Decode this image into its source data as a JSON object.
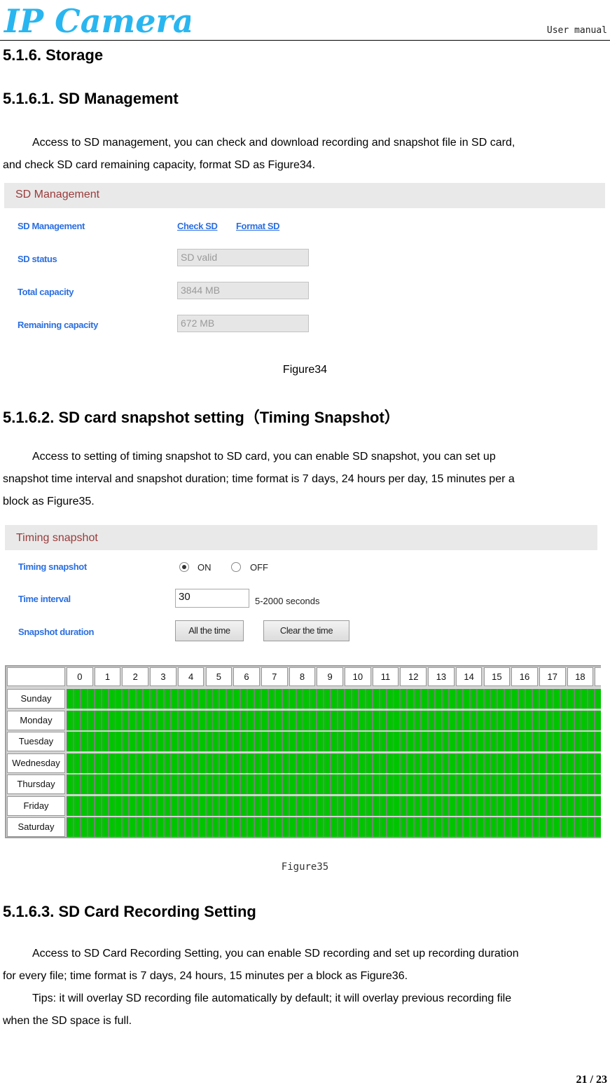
{
  "header": {
    "logo_text": "IP Camera",
    "right_label": "User manual",
    "logo_color": "#29b6f0"
  },
  "sections": {
    "s516": {
      "heading": "5.1.6.  Storage"
    },
    "s5161": {
      "heading": "5.1.6.1. SD Management",
      "paragraph_line1": "Access to SD management, you can check and download recording and snapshot file in SD card,",
      "paragraph_line2": "and check SD card remaining capacity, format SD as Figure34.",
      "caption": "Figure34"
    },
    "s5162": {
      "heading": "5.1.6.2. SD card snapshot setting（Timing Snapshot）",
      "paragraph_line1": "Access to setting of timing snapshot to SD card, you can enable SD snapshot, you can set up",
      "paragraph_line2": "snapshot time interval and snapshot duration; time format is 7 days, 24 hours per day, 15 minutes per a",
      "paragraph_line3": "block as Figure35.",
      "caption": "Figure35"
    },
    "s5163": {
      "heading": "5.1.6.3. SD Card Recording Setting",
      "paragraph1_line1": "Access to SD Card Recording Setting, you can enable SD recording and set up recording duration",
      "paragraph1_line2": "for every file; time format is 7 days, 24 hours, 15 minutes per a block as Figure36.",
      "paragraph2_line1": "Tips: it will overlay SD recording file automatically by default; it will overlay previous recording file",
      "paragraph2_line2": "when the SD space is full."
    }
  },
  "sd_management_panel": {
    "title": "SD Management",
    "row_management_label": "SD Management",
    "check_sd_link": "Check SD",
    "format_sd_link": "Format SD",
    "status_label": "SD status",
    "status_value": "SD valid",
    "total_label": "Total capacity",
    "total_value": "3844 MB",
    "remaining_label": "Remaining capacity",
    "remaining_value": "672 MB"
  },
  "timing_snapshot_panel": {
    "title": "Timing snapshot",
    "enable_label": "Timing snapshot",
    "on_label": "ON",
    "off_label": "OFF",
    "enabled": true,
    "interval_label": "Time interval",
    "interval_value": "30",
    "interval_hint": "5-2000 seconds",
    "duration_label": "Snapshot duration",
    "all_time_button": "All the time",
    "clear_time_button": "Clear the time",
    "schedule": {
      "hours_visible": [
        "0",
        "1",
        "2",
        "3",
        "4",
        "5",
        "6",
        "7",
        "8",
        "9",
        "10",
        "11",
        "12",
        "13",
        "14",
        "15",
        "16",
        "17",
        "18"
      ],
      "days": [
        "Sunday",
        "Monday",
        "Tuesday",
        "Wednesday",
        "Thursday",
        "Friday",
        "Saturday"
      ],
      "blocks_per_hour": 4,
      "all_blocks_selected": true,
      "selected_color": "#00c400"
    }
  },
  "footer": {
    "page_number": "21 / 23"
  }
}
